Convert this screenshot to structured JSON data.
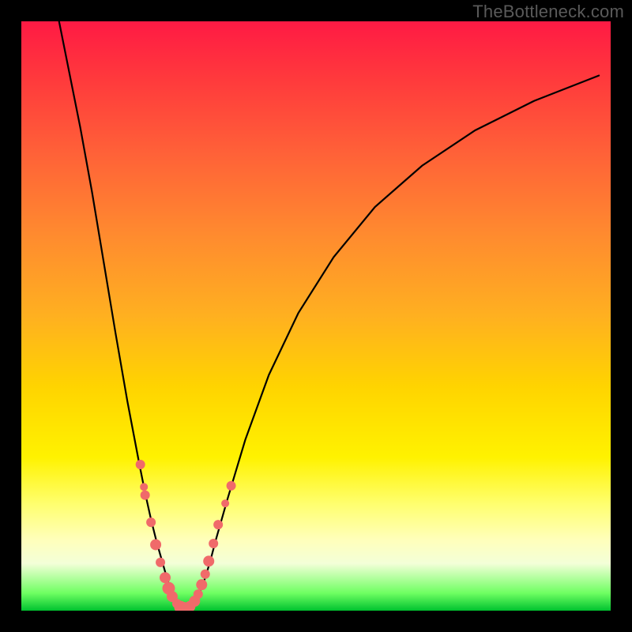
{
  "watermark": "TheBottleneck.com",
  "colors": {
    "frame": "#000000",
    "curve": "#000000",
    "dot": "#f06a6a",
    "gradient_top": "#ff1a44",
    "gradient_bottom": "#00c22f"
  },
  "chart_data": {
    "type": "line",
    "title": "",
    "xlabel": "",
    "ylabel": "",
    "xlim": [
      0,
      100
    ],
    "ylim": [
      0,
      100
    ],
    "curves": [
      {
        "name": "left-branch",
        "x": [
          6,
          8,
          10,
          12,
          14,
          16,
          18,
          20,
          21,
          22,
          23,
          24,
          24.8,
          25.5,
          26.2,
          27,
          28
        ],
        "y": [
          102,
          92,
          82,
          71,
          59,
          47,
          35.5,
          25,
          20,
          15.5,
          11.5,
          8,
          5.2,
          3.2,
          1.8,
          0.8,
          0.2
        ]
      },
      {
        "name": "right-branch",
        "x": [
          28,
          29,
          30,
          31,
          32,
          33,
          35,
          38,
          42,
          47,
          53,
          60,
          68,
          77,
          87,
          98
        ],
        "y": [
          0.2,
          1.0,
          2.5,
          5,
          8.2,
          12,
          19,
          29,
          40,
          50.5,
          60,
          68.5,
          75.5,
          81.5,
          86.5,
          90.8
        ]
      }
    ],
    "scatter": {
      "name": "highlight-dots",
      "x": [
        20.2,
        20.8,
        21.0,
        22.0,
        22.8,
        23.6,
        24.4,
        25.0,
        25.6,
        26.4,
        27.0,
        27.6,
        28.6,
        29.4,
        30.0,
        30.6,
        31.2,
        31.8,
        32.6,
        33.4,
        34.6,
        35.6
      ],
      "y": [
        24.8,
        21.0,
        19.6,
        15.0,
        11.2,
        8.2,
        5.6,
        3.8,
        2.4,
        1.2,
        0.6,
        0.4,
        0.7,
        1.6,
        2.8,
        4.4,
        6.2,
        8.4,
        11.4,
        14.6,
        18.2,
        21.2
      ],
      "r": [
        6,
        5,
        6,
        6,
        7,
        6,
        7,
        8,
        7,
        6,
        8,
        8,
        7,
        7,
        6,
        7,
        6,
        7,
        6,
        6,
        5,
        6
      ]
    }
  }
}
